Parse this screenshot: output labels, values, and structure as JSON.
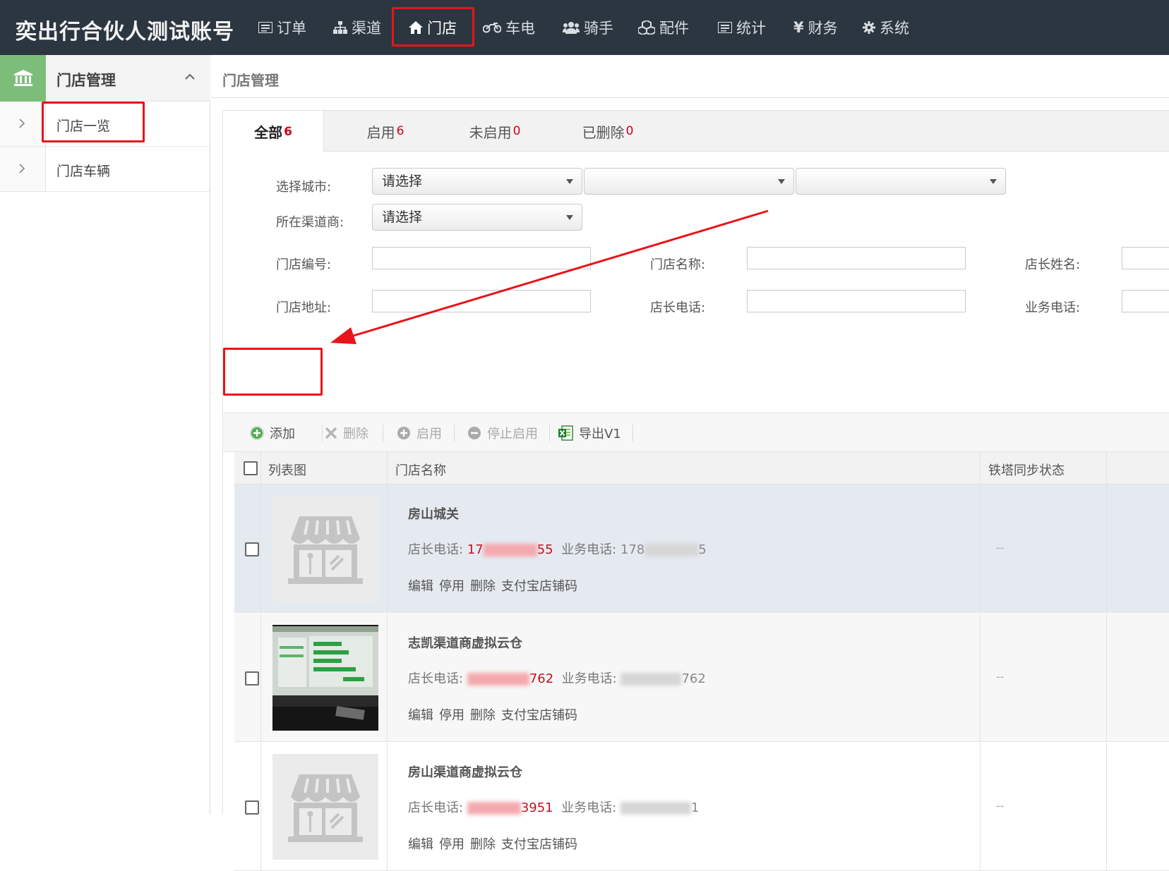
{
  "app": {
    "title": "奕出行合伙人测试账号"
  },
  "nav": [
    {
      "label": "订单",
      "icon": "list-icon"
    },
    {
      "label": "渠道",
      "icon": "sitemap-icon"
    },
    {
      "label": "门店",
      "icon": "home-icon",
      "active": true
    },
    {
      "label": "车电",
      "icon": "motorcycle-icon"
    },
    {
      "label": "骑手",
      "icon": "users-icon"
    },
    {
      "label": "配件",
      "icon": "cubes-icon"
    },
    {
      "label": "统计",
      "icon": "list-icon"
    },
    {
      "label": "财务",
      "icon": "yen-icon"
    },
    {
      "label": "系统",
      "icon": "gear-icon"
    }
  ],
  "sidebar": {
    "title": "门店管理",
    "items": [
      {
        "label": "门店一览"
      },
      {
        "label": "门店车辆"
      }
    ]
  },
  "main": {
    "breadcrumb": "门店管理",
    "tabs": [
      {
        "label": "全部",
        "count": "6"
      },
      {
        "label": "启用",
        "count": "6"
      },
      {
        "label": "未启用",
        "count": "0"
      },
      {
        "label": "已删除",
        "count": "0"
      }
    ],
    "filters": {
      "city_label": "选择城市:",
      "city_select": "请选择",
      "channel_label": "所在渠道商:",
      "channel_select": "请选择",
      "store_no_label": "门店编号:",
      "store_name_label": "门店名称:",
      "manager_name_label": "店长姓名:",
      "address_label": "门店地址:",
      "manager_phone_label": "店长电话:",
      "business_phone_label": "业务电话:"
    },
    "toolbar": {
      "add": "添加",
      "delete": "删除",
      "enable": "启用",
      "disable": "停止启用",
      "export": "导出V1"
    },
    "table": {
      "col_image": "列表图",
      "col_name": "门店名称",
      "col_sync": "铁塔同步状态",
      "phone_label": "店长电话:",
      "business_label": "业务电话:",
      "actions": [
        "编辑",
        "停用",
        "删除",
        "支付宝店铺码"
      ],
      "rows": [
        {
          "name": "房山城关",
          "manager_phone_start": "17",
          "manager_phone_end": "55",
          "business_phone_start": "178",
          "business_phone_end": "5",
          "sync": "--",
          "image": "store-placeholder"
        },
        {
          "name": "志凯渠道商虚拟云仓",
          "manager_phone_start": "",
          "manager_phone_end": "762",
          "business_phone_start": "",
          "business_phone_end": "762",
          "sync": "--",
          "image": "screenshot-photo"
        },
        {
          "name": "房山渠道商虚拟云仓",
          "manager_phone_start": "",
          "manager_phone_end": "3951",
          "business_phone_start": "",
          "business_phone_end": "1",
          "sync": "--",
          "image": "store-placeholder"
        }
      ]
    }
  },
  "colors": {
    "topbar": "#2c3640",
    "sidebar_accent": "#7dbd7a",
    "count_red": "#d0021b",
    "highlight": "#e8141a"
  }
}
